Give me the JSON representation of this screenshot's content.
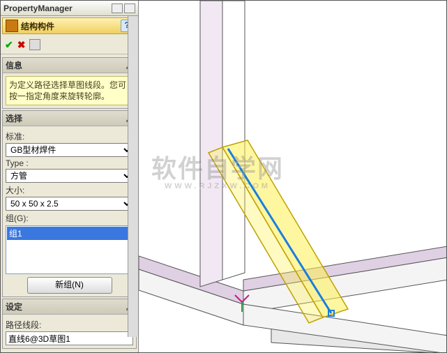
{
  "window": {
    "title": "PropertyManager"
  },
  "feature": {
    "title": "结构构件"
  },
  "actions": {
    "ok": "✔",
    "cancel": "✖"
  },
  "info": {
    "header": "信息",
    "body": "为定义路径选择草图线段。您可按一指定角度来旋转轮廓。"
  },
  "select": {
    "header": "选择",
    "standard_label": "标准:",
    "standard_value": "GB型材焊件",
    "type_label": "Type :",
    "type_value": "方管",
    "size_label": "大小:",
    "size_value": "50 x 50 x 2.5",
    "group_label": "组(G):",
    "group_item": "组1",
    "newgroup_btn": "新组(N)"
  },
  "settings": {
    "header": "设定",
    "path_label": "路径线段:",
    "path_value": "直线6@3D草图1"
  },
  "watermark": {
    "main": "软件自学网",
    "sub": "WWW.RJZXW.COM"
  }
}
